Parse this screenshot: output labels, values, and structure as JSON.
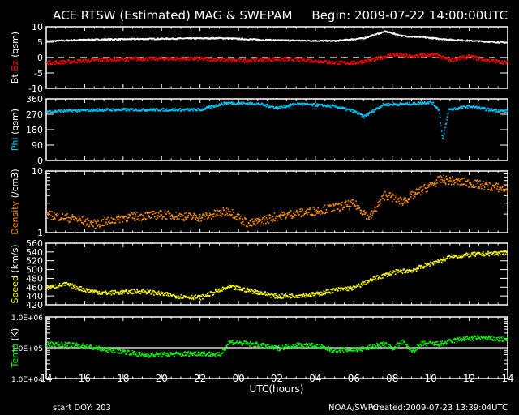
{
  "header": {
    "title": "ACE RTSW (Estimated) MAG & SWEPAM",
    "begin": "Begin: 2009-07-22 14:00:00UTC"
  },
  "footer": {
    "start_doy": "start DOY: 203",
    "source": "NOAA/SWPC",
    "created": "created:2009-07-23 13:39:04UTC"
  },
  "chart_data": {
    "type": "scatter",
    "xlabel": "UTC(hours)",
    "xlim": [
      0,
      24
    ],
    "x_tick_labels": [
      "14",
      "16",
      "18",
      "20",
      "22",
      "00",
      "02",
      "04",
      "06",
      "08",
      "10",
      "12",
      "14"
    ],
    "panels": [
      {
        "id": "mag",
        "ylabel_parts": [
          {
            "text": "Bt",
            "color": "#ffffff"
          },
          {
            "text": " Bz",
            "color": "#ff0000"
          },
          {
            "text": " (gsm)",
            "color": "#ffffff"
          }
        ],
        "scale": "linear",
        "ylim": [
          -10,
          10
        ],
        "y_tick_labels": [
          {
            "v": 10,
            "t": "10"
          },
          {
            "v": 5,
            "t": "5"
          },
          {
            "v": 0,
            "t": "0"
          },
          {
            "v": -5,
            "t": "-5"
          },
          {
            "v": -10,
            "t": "-10"
          }
        ],
        "reference_line": {
          "value": 0,
          "style": "dashed"
        },
        "series": [
          {
            "name": "Bt",
            "color": "#ffffff",
            "noise": 0.2,
            "points": [
              [
                0,
                5.5
              ],
              [
                2,
                6
              ],
              [
                6,
                6.3
              ],
              [
                9,
                6.5
              ],
              [
                12,
                5.8
              ],
              [
                15,
                5.6
              ],
              [
                16.5,
                6.5
              ],
              [
                17.6,
                8.7
              ],
              [
                18.5,
                7.2
              ],
              [
                19.5,
                6.8
              ],
              [
                21,
                6
              ],
              [
                22.5,
                5.5
              ],
              [
                24,
                5
              ]
            ]
          },
          {
            "name": "Bz",
            "color": "#ff0000",
            "noise": 0.6,
            "points": [
              [
                0,
                -1.5
              ],
              [
                1,
                -1.2
              ],
              [
                3,
                -0.5
              ],
              [
                5,
                -0.2
              ],
              [
                8,
                -0.2
              ],
              [
                10,
                -0.8
              ],
              [
                12,
                -0.3
              ],
              [
                13.5,
                -0.6
              ],
              [
                15,
                -1.5
              ],
              [
                16,
                -1.5
              ],
              [
                17,
                -0.5
              ],
              [
                18,
                1.2
              ],
              [
                19,
                0.5
              ],
              [
                20,
                1.2
              ],
              [
                21,
                -0.5
              ],
              [
                22,
                0.5
              ],
              [
                23,
                -0.8
              ],
              [
                24,
                -1.5
              ]
            ]
          }
        ]
      },
      {
        "id": "phi",
        "ylabel_parts": [
          {
            "text": "Phi",
            "color": "#00c8ff"
          },
          {
            "text": " (gsm)",
            "color": "#ffffff"
          }
        ],
        "scale": "linear",
        "ylim": [
          0,
          360
        ],
        "y_tick_labels": [
          {
            "v": 360,
            "t": "360"
          },
          {
            "v": 270,
            "t": "270"
          },
          {
            "v": 180,
            "t": "180"
          },
          {
            "v": 90,
            "t": "90"
          },
          {
            "v": 0,
            "t": "0"
          }
        ],
        "series": [
          {
            "name": "Phi",
            "color": "#00c8ff",
            "noise": 8,
            "points": [
              [
                0,
                290
              ],
              [
                3,
                300
              ],
              [
                8,
                300
              ],
              [
                9.3,
                340
              ],
              [
                11,
                335
              ],
              [
                12,
                310
              ],
              [
                13,
                335
              ],
              [
                15,
                320
              ],
              [
                16,
                290
              ],
              [
                16.5,
                260
              ],
              [
                17.5,
                330
              ],
              [
                19,
                335
              ],
              [
                20,
                345
              ],
              [
                20.4,
                300
              ],
              [
                20.6,
                120
              ],
              [
                20.9,
                300
              ],
              [
                22,
                320
              ],
              [
                23,
                300
              ],
              [
                24,
                290
              ]
            ]
          }
        ]
      },
      {
        "id": "density",
        "ylabel_parts": [
          {
            "text": "Density",
            "color": "#ff8c00"
          },
          {
            "text": " (/cm3)",
            "color": "#ffffff"
          }
        ],
        "scale": "log",
        "ylim": [
          1,
          10
        ],
        "y_tick_labels": [
          {
            "v": 10,
            "t": "10"
          },
          {
            "v": 1,
            "t": "1"
          }
        ],
        "series": [
          {
            "name": "Density",
            "color": "#ff8c00",
            "noise": 0.07,
            "points": [
              [
                0,
                2
              ],
              [
                1.5,
                1.7
              ],
              [
                2.5,
                1.4
              ],
              [
                4,
                1.8
              ],
              [
                6,
                2
              ],
              [
                8,
                1.8
              ],
              [
                9.5,
                2.3
              ],
              [
                10.5,
                1.4
              ],
              [
                12,
                1.9
              ],
              [
                14,
                2.3
              ],
              [
                16,
                3
              ],
              [
                16.8,
                1.8
              ],
              [
                17.6,
                4.2
              ],
              [
                18.5,
                3.3
              ],
              [
                19.5,
                5
              ],
              [
                20.5,
                7.5
              ],
              [
                22,
                6.5
              ],
              [
                24,
                5.2
              ]
            ]
          }
        ]
      },
      {
        "id": "speed",
        "ylabel_parts": [
          {
            "text": "Speed",
            "color": "#ffff00"
          },
          {
            "text": " (km/s)",
            "color": "#ffffff"
          }
        ],
        "scale": "linear",
        "ylim": [
          420,
          560
        ],
        "y_tick_labels": [
          {
            "v": 560,
            "t": "560"
          },
          {
            "v": 540,
            "t": "540"
          },
          {
            "v": 520,
            "t": "520"
          },
          {
            "v": 500,
            "t": "500"
          },
          {
            "v": 480,
            "t": "480"
          },
          {
            "v": 460,
            "t": "460"
          },
          {
            "v": 440,
            "t": "440"
          },
          {
            "v": 420,
            "t": "420"
          }
        ],
        "series": [
          {
            "name": "Speed",
            "color": "#ffff00",
            "noise": 5,
            "points": [
              [
                0,
                460
              ],
              [
                1,
                468
              ],
              [
                2,
                455
              ],
              [
                3,
                448
              ],
              [
                5,
                452
              ],
              [
                7,
                440
              ],
              [
                8,
                438
              ],
              [
                9.5,
                462
              ],
              [
                11,
                450
              ],
              [
                12,
                440
              ],
              [
                14,
                445
              ],
              [
                15,
                455
              ],
              [
                16,
                460
              ],
              [
                17,
                480
              ],
              [
                18,
                495
              ],
              [
                19,
                500
              ],
              [
                20,
                515
              ],
              [
                21,
                530
              ],
              [
                22,
                535
              ],
              [
                24,
                540
              ]
            ]
          }
        ]
      },
      {
        "id": "temp",
        "ylabel_parts": [
          {
            "text": "Temp",
            "color": "#00ff00"
          },
          {
            "text": " (K)",
            "color": "#ffffff"
          }
        ],
        "scale": "log",
        "ylim": [
          10000,
          1000000
        ],
        "y_tick_labels": [
          {
            "v": 1000000,
            "t": "1.0E+06"
          },
          {
            "v": 100000,
            "t": "1.0E+05"
          },
          {
            "v": 10000,
            "t": "1.0E+04"
          }
        ],
        "reference_line": {
          "value": 100000,
          "style": "solid"
        },
        "series": [
          {
            "name": "Temp",
            "color": "#00ff00",
            "noise": 0.08,
            "points": [
              [
                0,
                140000
              ],
              [
                2,
                120000
              ],
              [
                3,
                90000
              ],
              [
                4,
                80000
              ],
              [
                5,
                60000
              ],
              [
                7,
                65000
              ],
              [
                8,
                70000
              ],
              [
                9,
                60000
              ],
              [
                9.5,
                160000
              ],
              [
                11,
                130000
              ],
              [
                12,
                100000
              ],
              [
                13,
                130000
              ],
              [
                14,
                120000
              ],
              [
                15,
                85000
              ],
              [
                16.5,
                95000
              ],
              [
                17.5,
                140000
              ],
              [
                18,
                100000
              ],
              [
                18.5,
                160000
              ],
              [
                19,
                80000
              ],
              [
                19.5,
                140000
              ],
              [
                20.5,
                140000
              ],
              [
                21.5,
                200000
              ],
              [
                22.5,
                220000
              ],
              [
                24,
                190000
              ]
            ]
          }
        ]
      }
    ]
  }
}
